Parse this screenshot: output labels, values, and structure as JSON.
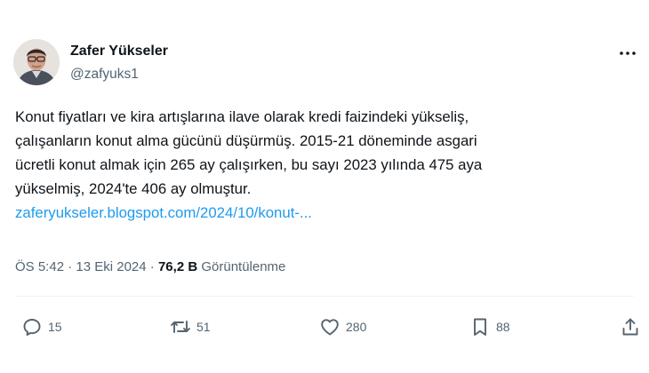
{
  "author": {
    "display_name": "Zafer Yükseler",
    "handle": "@zafyuks1"
  },
  "tweet": {
    "lines": [
      "Konut fiyatları ve kira artışlarına ilave olarak kredi faizindeki yükseliş,",
      "çalışanların konut alma gücünü düşürmüş. 2015-21 döneminde asgari",
      "ücretli konut almak için 265 ay çalışırken, bu sayı 2023 yılında 475 aya",
      "yükselmiş, 2024'te 406 ay olmuştur."
    ],
    "link_text": "zaferyukseler.blogspot.com/2024/10/konut-..."
  },
  "meta": {
    "time": "ÖS 5:42",
    "separator": "·",
    "date": "13 Eki 2024",
    "views_count": "76,2 B",
    "views_label": "Görüntülenme"
  },
  "actions": {
    "replies": "15",
    "retweets": "51",
    "likes": "280",
    "bookmarks": "88"
  },
  "colors": {
    "link": "#1d9bf0",
    "secondary_text": "#536471",
    "primary_text": "#0f1419"
  },
  "icons": [
    "more-icon",
    "reply-icon",
    "retweet-icon",
    "like-icon",
    "bookmark-icon",
    "share-icon"
  ]
}
